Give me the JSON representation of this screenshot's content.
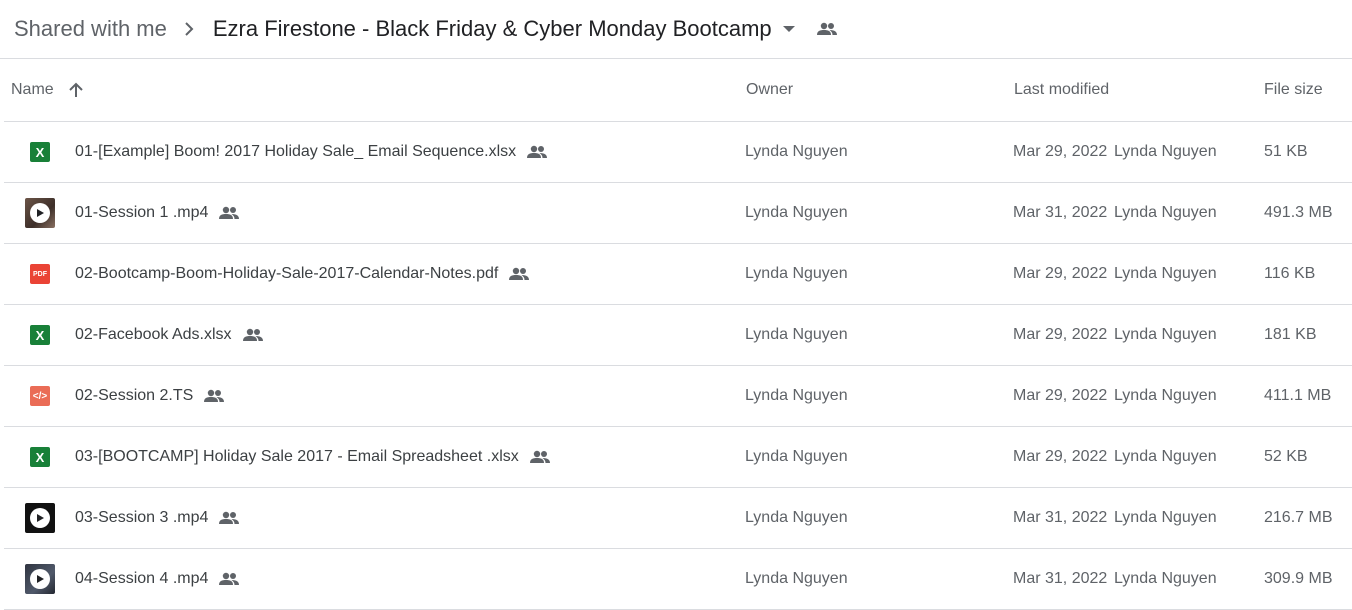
{
  "breadcrumb": {
    "root": "Shared with me",
    "current": "Ezra Firestone - Black Friday & Cyber Monday Bootcamp"
  },
  "columns": {
    "name": "Name",
    "owner": "Owner",
    "last_modified": "Last modified",
    "file_size": "File size"
  },
  "sort": {
    "column": "name",
    "direction": "ascending"
  },
  "colors": {
    "spreadsheet": "#188038",
    "pdf": "#ea4335",
    "code": "#ea6c56",
    "text": "#3c4043",
    "secondary": "#5f6368",
    "divider": "#dadce0"
  },
  "files": [
    {
      "name": "01-[Example] Boom! 2017 Holiday Sale_ Email Sequence.xlsx",
      "icon": "spreadsheet-icon",
      "owner": "Lynda Nguyen",
      "modified_date": "Mar 29, 2022",
      "modified_by": "Lynda Nguyen",
      "size": "51 KB"
    },
    {
      "name": "01-Session 1 .mp4",
      "icon": "video-thumbnail-icon",
      "owner": "Lynda Nguyen",
      "modified_date": "Mar 31, 2022",
      "modified_by": "Lynda Nguyen",
      "size": "491.3 MB"
    },
    {
      "name": "02-Bootcamp-Boom-Holiday-Sale-2017-Calendar-Notes.pdf",
      "icon": "pdf-icon",
      "owner": "Lynda Nguyen",
      "modified_date": "Mar 29, 2022",
      "modified_by": "Lynda Nguyen",
      "size": "116 KB"
    },
    {
      "name": "02-Facebook Ads.xlsx",
      "icon": "spreadsheet-icon",
      "owner": "Lynda Nguyen",
      "modified_date": "Mar 29, 2022",
      "modified_by": "Lynda Nguyen",
      "size": "181 KB"
    },
    {
      "name": "02-Session 2.TS",
      "icon": "code-file-icon",
      "owner": "Lynda Nguyen",
      "modified_date": "Mar 29, 2022",
      "modified_by": "Lynda Nguyen",
      "size": "411.1 MB"
    },
    {
      "name": "03-[BOOTCAMP] Holiday Sale 2017 - Email Spreadsheet .xlsx",
      "icon": "spreadsheet-icon",
      "owner": "Lynda Nguyen",
      "modified_date": "Mar 29, 2022",
      "modified_by": "Lynda Nguyen",
      "size": "52 KB"
    },
    {
      "name": "03-Session 3 .mp4",
      "icon": "video-thumbnail-icon",
      "owner": "Lynda Nguyen",
      "modified_date": "Mar 31, 2022",
      "modified_by": "Lynda Nguyen",
      "size": "216.7 MB"
    },
    {
      "name": "04-Session 4 .mp4",
      "icon": "video-thumbnail-icon",
      "owner": "Lynda Nguyen",
      "modified_date": "Mar 31, 2022",
      "modified_by": "Lynda Nguyen",
      "size": "309.9 MB"
    }
  ]
}
